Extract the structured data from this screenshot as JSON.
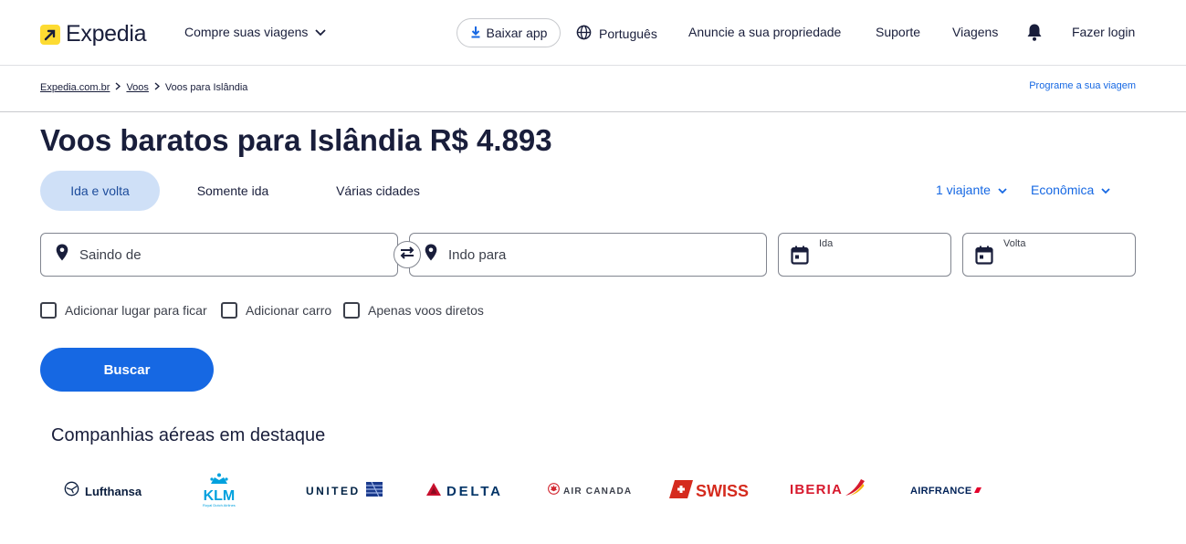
{
  "header": {
    "logo_text": "Expedia",
    "shop_label": "Compre suas viagens",
    "app_button": "Baixar app",
    "language": "Português",
    "list_property": "Anuncie a sua propriedade",
    "support": "Suporte",
    "trips": "Viagens",
    "login": "Fazer login"
  },
  "breadcrumb": {
    "home": "Expedia.com.br",
    "flights": "Voos",
    "current": "Voos para Islândia",
    "plan_link": "Programe a sua viagem"
  },
  "page_title": "Voos baratos para Islândia R$ 4.893",
  "tabs": [
    {
      "label": "Ida e volta",
      "active": true
    },
    {
      "label": "Somente ida",
      "active": false
    },
    {
      "label": "Várias cidades",
      "active": false
    }
  ],
  "travelers": "1 viajante",
  "cabin_class": "Econômica",
  "search": {
    "origin_placeholder": "Saindo de",
    "destination_placeholder": "Indo para",
    "depart_label": "Ida",
    "return_label": "Volta"
  },
  "options": [
    {
      "label": "Adicionar lugar para ficar",
      "checked": false
    },
    {
      "label": "Adicionar carro",
      "checked": false
    },
    {
      "label": "Apenas voos diretos",
      "checked": false
    }
  ],
  "search_button": "Buscar",
  "airlines_section_title": "Companhias aéreas em destaque",
  "airlines": [
    {
      "name": "Lufthansa",
      "logo_text": "Lufthansa",
      "color": "#0a1d3d"
    },
    {
      "name": "KLM",
      "logo_text": "KLM",
      "sub_text": "Royal Dutch Airlines",
      "color": "#00a1de"
    },
    {
      "name": "United",
      "logo_text": "UNITED",
      "color": "#002244"
    },
    {
      "name": "Delta",
      "logo_text": "DELTA",
      "color": "#003366"
    },
    {
      "name": "Air Canada",
      "logo_text": "AIR CANADA",
      "color": "#d22630"
    },
    {
      "name": "Swiss",
      "logo_text": "SWISS",
      "color": "#d52b1e"
    },
    {
      "name": "Iberia",
      "logo_text": "IBERIA",
      "color": "#d7192d"
    },
    {
      "name": "Air France",
      "logo_text": "AIRFRANCE",
      "color": "#002157"
    }
  ],
  "colors": {
    "brand_yellow": "#fddb32",
    "primary_blue": "#1668e3",
    "text_dark": "#191e3b",
    "active_tab_bg": "#cfe0f7"
  }
}
